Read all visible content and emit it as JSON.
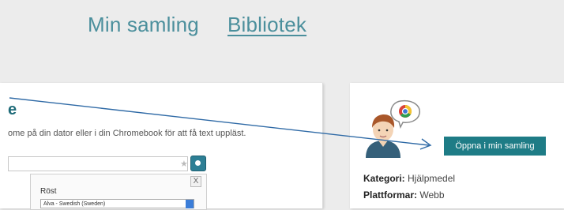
{
  "nav": {
    "items": [
      {
        "label": "Min samling"
      },
      {
        "label": "Bibliotek"
      }
    ]
  },
  "left_card": {
    "title": "e",
    "description": "ome på din dator eller i din Chromebook för att få text uppläst.",
    "popup": {
      "close": "X",
      "voice_label": "Röst",
      "voice_value": "Alva - Swedish (Sweden)"
    }
  },
  "right_card": {
    "open_button": "Öppna i min samling",
    "category_label": "Kategori:",
    "category_value": "Hjälpmedel",
    "platforms_label": "Plattformar:",
    "platforms_value": "Webb"
  },
  "colors": {
    "accent": "#1e7c86",
    "nav_text": "#4b8f9c",
    "arrow": "#2f6aa6"
  }
}
